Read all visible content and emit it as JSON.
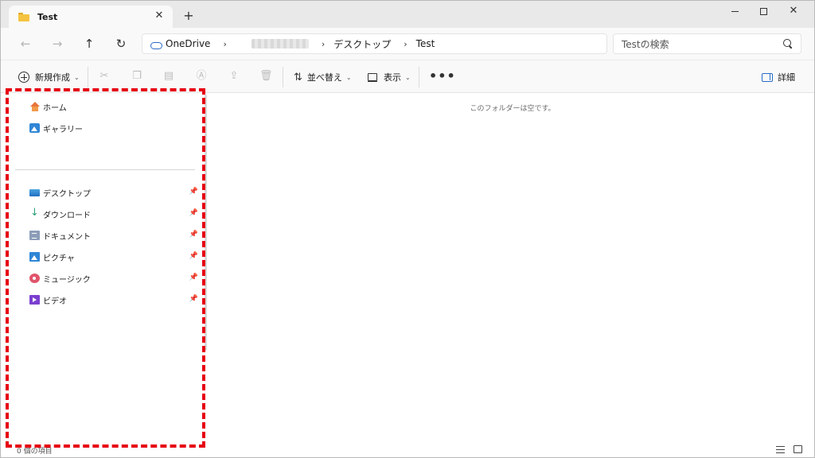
{
  "tab": {
    "title": "Test",
    "close_glyph": "✕",
    "new_tab_glyph": "+"
  },
  "window_controls": {
    "close_glyph": "✕"
  },
  "address": {
    "crumbs": [
      "OneDrive",
      "デスクトップ",
      "Test"
    ],
    "separator": "›"
  },
  "search": {
    "placeholder": "Testの検索"
  },
  "toolbar": {
    "new_label": "新規作成",
    "sort_label": "並べ替え",
    "view_label": "表示",
    "more_label": "•••",
    "details_label": "詳細"
  },
  "nav_pane": {
    "items_top": [
      {
        "label": "ホーム",
        "icon": "home-icon"
      },
      {
        "label": "ギャラリー",
        "icon": "gallery-icon"
      }
    ],
    "items_pinned": [
      {
        "label": "デスクトップ",
        "icon": "desktop-icon"
      },
      {
        "label": "ダウンロード",
        "icon": "download-icon"
      },
      {
        "label": "ドキュメント",
        "icon": "documents-icon"
      },
      {
        "label": "ピクチャ",
        "icon": "pictures-icon"
      },
      {
        "label": "ミュージック",
        "icon": "music-icon"
      },
      {
        "label": "ビデオ",
        "icon": "video-icon"
      }
    ],
    "pin_glyph": "📌"
  },
  "content": {
    "empty_message": "このフォルダーは空です。"
  },
  "status": {
    "text": "0 個の項目"
  },
  "colors": {
    "highlight": "#e60012",
    "accent": "#2a6cc7",
    "folder": "#f5c342"
  }
}
